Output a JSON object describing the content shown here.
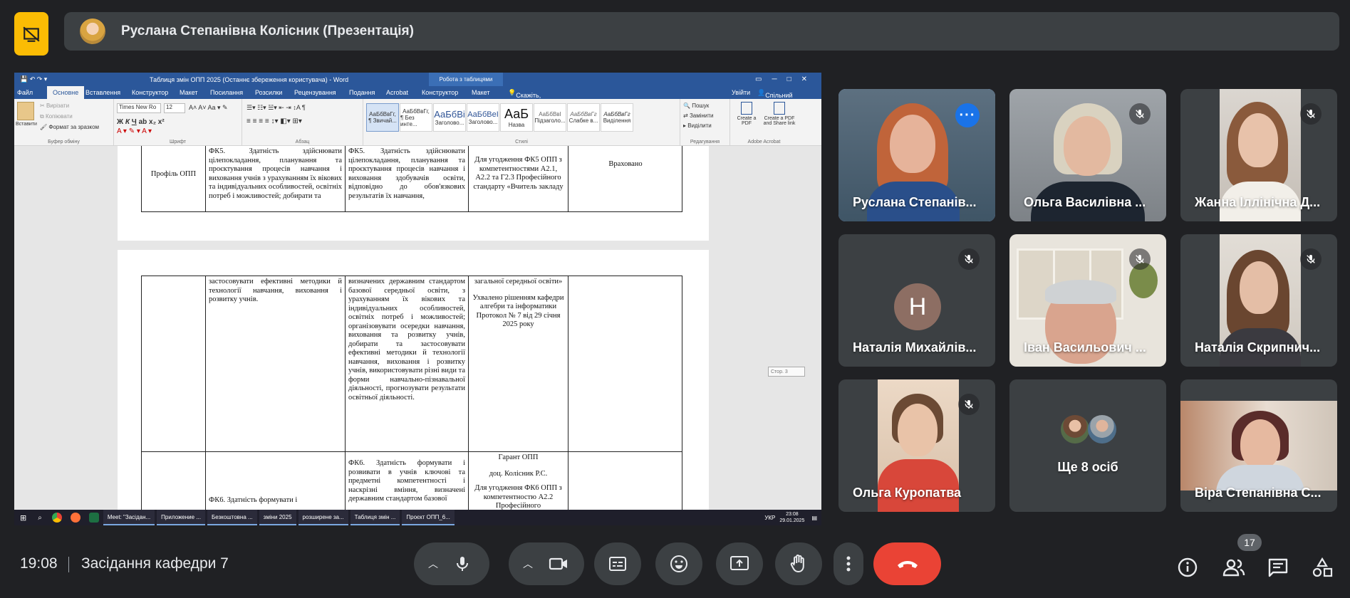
{
  "presenter": {
    "name": "Руслана Степанівна Колісник (Презентація)"
  },
  "word": {
    "title": "Таблиця змін ОПП 2025 (Останнє збереження користувача) - Word",
    "context_tab": "Робота з таблицями",
    "tabs": [
      "Файл",
      "Основне",
      "Вставлення",
      "Конструктор",
      "Макет",
      "Посилання",
      "Розсилки",
      "Рецензування",
      "Подання",
      "Acrobat",
      "Конструктор",
      "Макет"
    ],
    "tell_me": "Скажіть, що потрібно зробити...",
    "sign_in": "Увійти",
    "share": "Спільний доступ",
    "ribbon": {
      "paste": "Вставити",
      "cut": "Вирізати",
      "copy": "Копіювати",
      "format_painter": "Формат за зразком",
      "clipboard": "Буфер обміну",
      "font_name": "Times New Ro",
      "font_size": "12",
      "font_group": "Шрифт",
      "paragraph": "Абзац",
      "styles_group": "Стилі",
      "styles": [
        {
          "sample": "АаБбВвГг,",
          "name": "¶ Звичай..."
        },
        {
          "sample": "АаБбВвГг,",
          "name": "¶ Без инте..."
        },
        {
          "sample": "АаБбВі",
          "name": "Заголово..."
        },
        {
          "sample": "АаБбВеІ",
          "name": "Заголово..."
        },
        {
          "sample": "АаБ",
          "name": "Назва"
        },
        {
          "sample": "АаБбВвІ",
          "name": "Підзаголо..."
        },
        {
          "sample": "АаБбВвГг",
          "name": "Слабке в..."
        },
        {
          "sample": "АаБбВвГг",
          "name": "Виділення"
        }
      ],
      "find": "Пошук",
      "replace": "Замінити",
      "select": "Виділити",
      "editing": "Редагування",
      "create_pdf": "Create a PDF",
      "create_share": "Create a PDF and Share link",
      "adobe": "Adobe Acrobat"
    },
    "doc": {
      "r1c1": "Профіль ОПП",
      "r1c2": "ФК5. Здатність здійснювати цілепокладання, планування та проєктування процесів навчання і виховання учнів з урахуванням їх вікових та індивідуальних особливостей, освітніх потреб і можливостей; добирати та",
      "r1c3": "ФК5. Здатність здійснювати цілепокладання, планування та проєктування процесів навчання і виховання здобувачів освіти, відповідно до обов'язкових результатів їх навчання,",
      "r1c4": "Для угодження ФК5 ОПП з компетентностями А2.1, А2.2 та Г2.3 Професійного стандарту «Вчитель закладу",
      "r1c5": "Враховано",
      "r2c2": "застосовувати ефективні методики й технології навчання, виховання і розвитку учнів.",
      "r2c3": "визначених державним стандартом базової середньої освіти, з урахуванням їх вікових та індивідуальних особливостей, освітніх потреб і можливостей; організовувати осередки навчання, виховання та розвитку учнів, добирати та застосовувати ефективні методики й технології навчання, виховання і розвитку учнів, використовувати різні види та форми навчально-пізнавальної діяльності, прогнозувати результати освітньої діяльності.",
      "r2c4a": "загальної середньої освіти»",
      "r2c4b": "Ухвалено рішенням кафедри алгебри та інформатики Протокол № 7 від 29 січня 2025 року",
      "r3c2": "ФК6. Здатність формувати і",
      "r3c3": "ФК6. Здатність формувати і розвивати в учнів ключові та предметні компетентності і наскрізні вміння, визначені державним стандартом базової",
      "r3c4a": "Гарант ОПП",
      "r3c4b": "доц. Колісник Р.С.",
      "r3c4c": "Для угодження ФК6 ОПП з компетентностю А2.2 Професійного",
      "page_marker": "Стор. 3"
    },
    "taskbar": {
      "items": [
        "Meet: \"Засідан...",
        "Приложение ...",
        "Безкоштовна ...",
        "зміни 2025",
        "розширене за...",
        "Таблиця змін ...",
        "Проєкт ОПП_6..."
      ],
      "lang": "УКР",
      "time": "23:08",
      "date": "29.01.2025"
    }
  },
  "participants": [
    {
      "name": "Руслана Степанів..."
    },
    {
      "name": "Ольга Василівна ..."
    },
    {
      "name": "Жанна Іллінічна Д..."
    },
    {
      "name": "Наталія Михайлів...",
      "initial": "Н"
    },
    {
      "name": "Іван Васильович ..."
    },
    {
      "name": "Наталія Скрипнич..."
    },
    {
      "name": "Ольга Куропатва"
    },
    {
      "name": "Ще 8 осіб"
    },
    {
      "name": "Віра Степанівна С..."
    }
  ],
  "footer": {
    "time": "19:08",
    "meeting": "Засідання кафедри 7",
    "people_count": "17"
  },
  "colors": {
    "bg": "#202124",
    "tile": "#3c4043",
    "accent": "#8ab4f8",
    "end_call": "#ea4335",
    "presenting": "#fbbc04"
  }
}
